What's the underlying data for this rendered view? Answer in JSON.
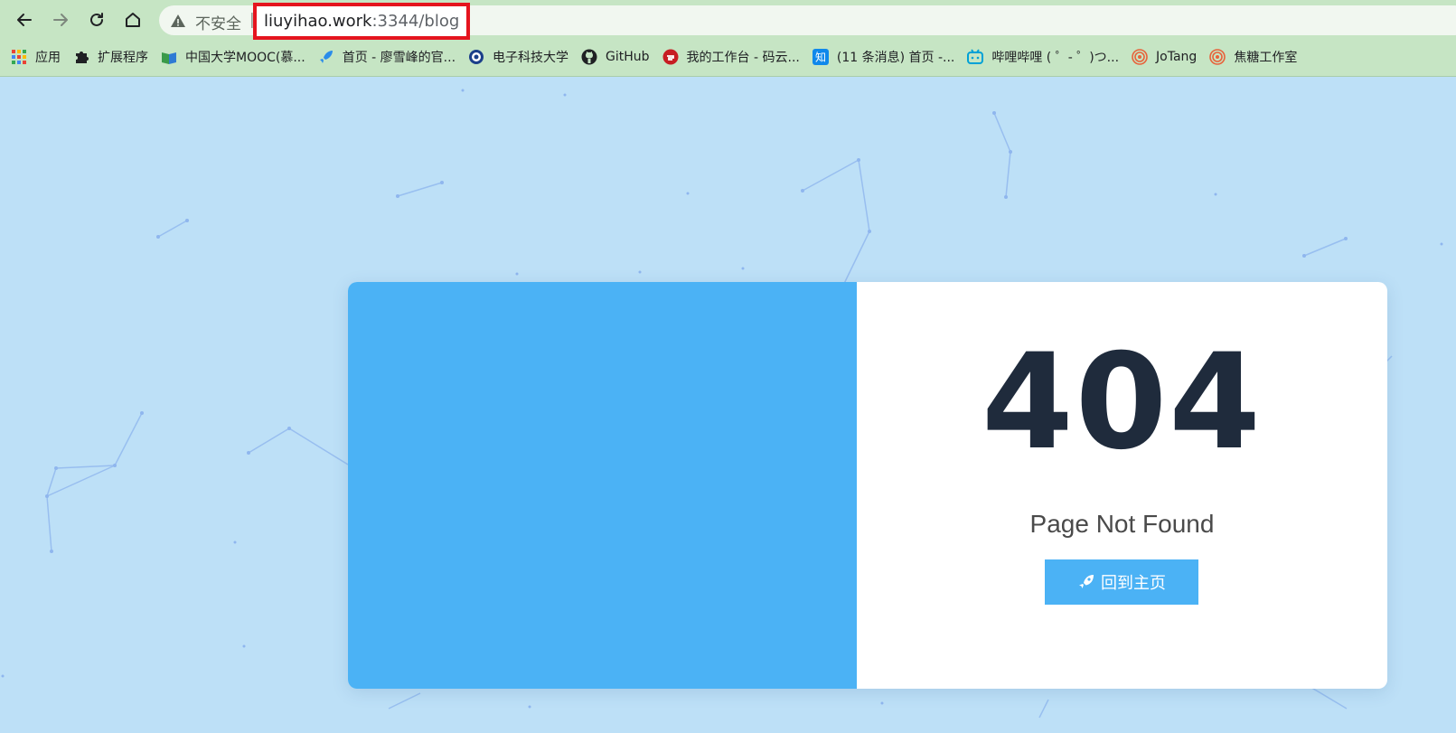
{
  "browser": {
    "insecure_label": "不安全",
    "separator": "|",
    "url_host": "liuyihao.work",
    "url_rest": ":3344/blog",
    "highlight_color": "#e5141e"
  },
  "bookmarks": [
    {
      "label": "应用",
      "icon": "apps-grid-icon"
    },
    {
      "label": "扩展程序",
      "icon": "puzzle-icon"
    },
    {
      "label": "中国大学MOOC(慕...",
      "icon": "book-icon"
    },
    {
      "label": "首页 - 廖雪峰的官...",
      "icon": "rocket-icon"
    },
    {
      "label": "电子科技大学",
      "icon": "university-emblem-icon"
    },
    {
      "label": "GitHub",
      "icon": "github-icon"
    },
    {
      "label": "我的工作台 - 码云...",
      "icon": "gitee-icon"
    },
    {
      "label": "(11 条消息) 首页 -...",
      "icon": "zhihu-icon"
    },
    {
      "label": "哔哩哔哩 ( ゜- ゜)つ...",
      "icon": "bilibili-icon"
    },
    {
      "label": "JoTang",
      "icon": "spiral-icon"
    },
    {
      "label": "焦糖工作室",
      "icon": "spiral-icon"
    }
  ],
  "page": {
    "error_code": "404",
    "message": "Page Not Found",
    "home_button": "回到主页",
    "accent_color": "#4bb2f5",
    "code_color": "#1f2b3c",
    "background_color": "#bde0f7"
  }
}
